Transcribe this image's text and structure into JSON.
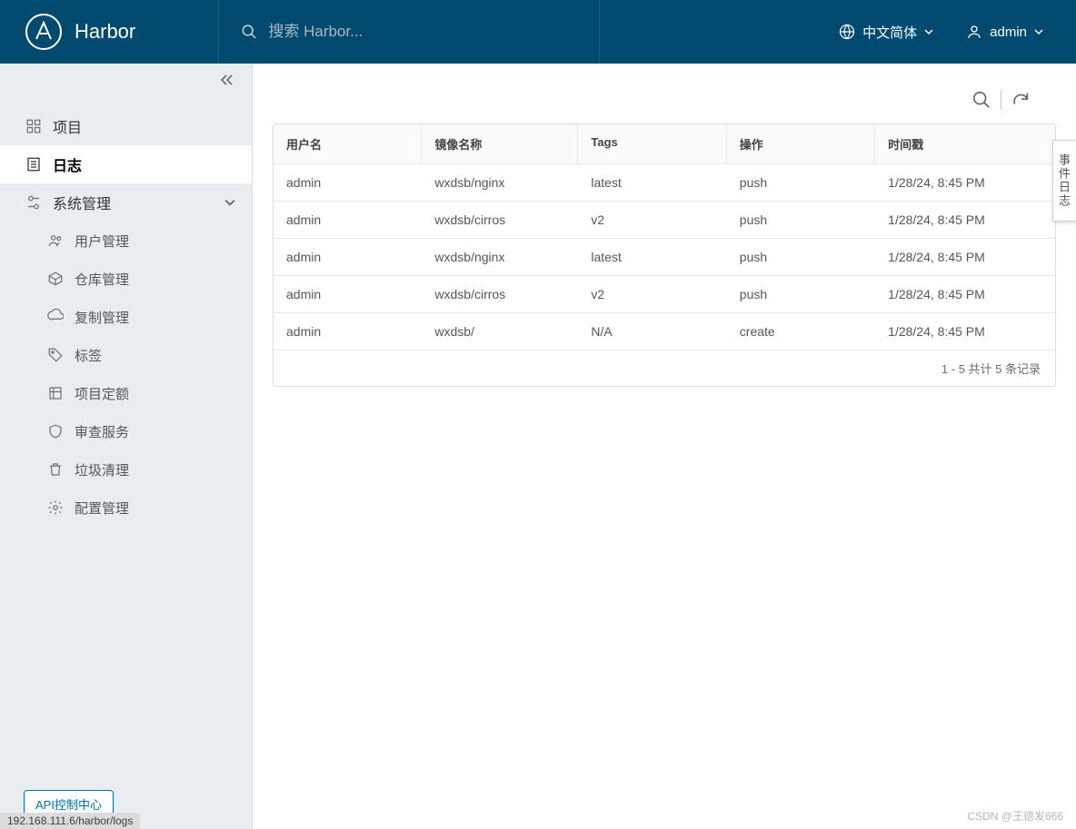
{
  "header": {
    "app_name": "Harbor",
    "search_placeholder": "搜索 Harbor...",
    "language_label": "中文简体",
    "user_name": "admin"
  },
  "sidebar": {
    "items": [
      {
        "label": "项目",
        "icon": "projects-icon"
      },
      {
        "label": "日志",
        "icon": "logs-icon"
      },
      {
        "label": "系统管理",
        "icon": "system-icon"
      }
    ],
    "system_children": [
      {
        "label": "用户管理",
        "icon": "users-icon"
      },
      {
        "label": "仓库管理",
        "icon": "registry-icon"
      },
      {
        "label": "复制管理",
        "icon": "replication-icon"
      },
      {
        "label": "标签",
        "icon": "tag-icon"
      },
      {
        "label": "项目定额",
        "icon": "quota-icon"
      },
      {
        "label": "审查服务",
        "icon": "shield-icon"
      },
      {
        "label": "垃圾清理",
        "icon": "trash-icon"
      },
      {
        "label": "配置管理",
        "icon": "gear-icon"
      }
    ],
    "api_button": "API控制中心"
  },
  "status_bar": "192.168.111.6/harbor/logs",
  "side_tab": "事件日志",
  "table": {
    "columns": {
      "user": "用户名",
      "repo": "镜像名称",
      "tag": "Tags",
      "op": "操作",
      "time": "时间戳"
    },
    "rows": [
      {
        "user": "admin",
        "repo": "wxdsb/nginx",
        "tag": "latest",
        "op": "push",
        "time": "1/28/24, 8:45 PM"
      },
      {
        "user": "admin",
        "repo": "wxdsb/cirros",
        "tag": "v2",
        "op": "push",
        "time": "1/28/24, 8:45 PM"
      },
      {
        "user": "admin",
        "repo": "wxdsb/nginx",
        "tag": "latest",
        "op": "push",
        "time": "1/28/24, 8:45 PM"
      },
      {
        "user": "admin",
        "repo": "wxdsb/cirros",
        "tag": "v2",
        "op": "push",
        "time": "1/28/24, 8:45 PM"
      },
      {
        "user": "admin",
        "repo": "wxdsb/",
        "tag": "N/A",
        "op": "create",
        "time": "1/28/24, 8:45 PM"
      }
    ],
    "footer": "1 - 5 共计 5 条记录"
  },
  "watermark": "CSDN @王德发666"
}
